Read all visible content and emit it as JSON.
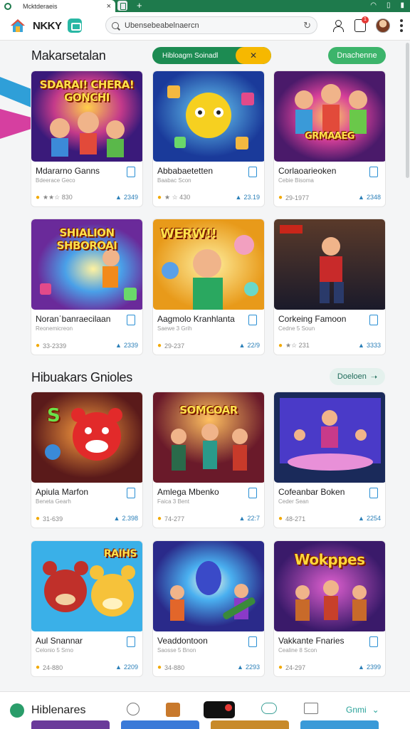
{
  "browser": {
    "tab_title": "Mcktderaeis",
    "new_tab": "+",
    "system_icons": [
      "wifi-icon",
      "tablet-icon",
      "battery-icon"
    ]
  },
  "nav": {
    "brand": "NKKY",
    "search_value": "Ubensebeabelnaercn",
    "notification_count": "1"
  },
  "sections": [
    {
      "title": "Makarsetalan",
      "search_pill": {
        "label": "Hibloagm Soinadl",
        "button": "✕"
      },
      "action_button": "Dnachenne",
      "cards": [
        {
          "name": "Mdararno Ganns",
          "sub": "Bdeerace Geco",
          "rating": "★★☆ 830",
          "likes": "2349",
          "art_text": "SDARAI! CHERA! GONCHI"
        },
        {
          "name": "Abbabaetetten",
          "sub": "Baabac Scon",
          "rating": "★ ☆ 430",
          "likes": "23.19",
          "art_text": ""
        },
        {
          "name": "Corlaoarieoken",
          "sub": "Cebie Bisoma",
          "rating": "29-1977",
          "likes": "2348",
          "art_text": "GRMAAEG"
        },
        {
          "name": "Noranˈbanraecilaan",
          "sub": "Reonemicreon",
          "rating": "33-2339",
          "likes": "2339",
          "art_text": "SHIALION SHBOROAI"
        },
        {
          "name": "Aagmolo Kranhlanta",
          "sub": "Saewe 3 Grih",
          "rating": "29-237",
          "likes": "22/9",
          "art_text": "WERW!!"
        },
        {
          "name": "Corkeing Famoon",
          "sub": "Cedne 5 Soun",
          "rating": "★☆ 231",
          "likes": "3333",
          "art_text": ""
        }
      ]
    },
    {
      "title": "Hibuakars Gnioles",
      "action_button": "Doeloen",
      "cards": [
        {
          "name": "Apiula Marfon",
          "sub": "Beneta Gearh",
          "rating": "31-639",
          "likes": "2.398",
          "art_text": "S"
        },
        {
          "name": "Amlega Mbenko",
          "sub": "Faica 3 Bent",
          "rating": "74-277",
          "likes": "22:7",
          "art_text": "SOMCOAR"
        },
        {
          "name": "Cofeanbar Boken",
          "sub": "Ceder Sean",
          "rating": "48-271",
          "likes": "2254",
          "art_text": ""
        },
        {
          "name": "Aul Snannar",
          "sub": "Celonio 5 Srno",
          "rating": "24-880",
          "likes": "2209",
          "art_text": "RAIHS"
        },
        {
          "name": "Veaddontoon",
          "sub": "Saosse 5 Bnon",
          "rating": "34-880",
          "likes": "2293",
          "art_text": ""
        },
        {
          "name": "Vakkante Fnaries",
          "sub": "Cealine 8 Scon",
          "rating": "24-297",
          "likes": "2399",
          "art_text": "Wokppes"
        }
      ]
    }
  ],
  "bottom": {
    "title": "Hiblenares",
    "more_label": "Gnmi"
  },
  "colors": {
    "brand_green": "#1e7a4c",
    "accent_yellow": "#f6b800",
    "bookmark_blue": "#2a8fd4"
  }
}
